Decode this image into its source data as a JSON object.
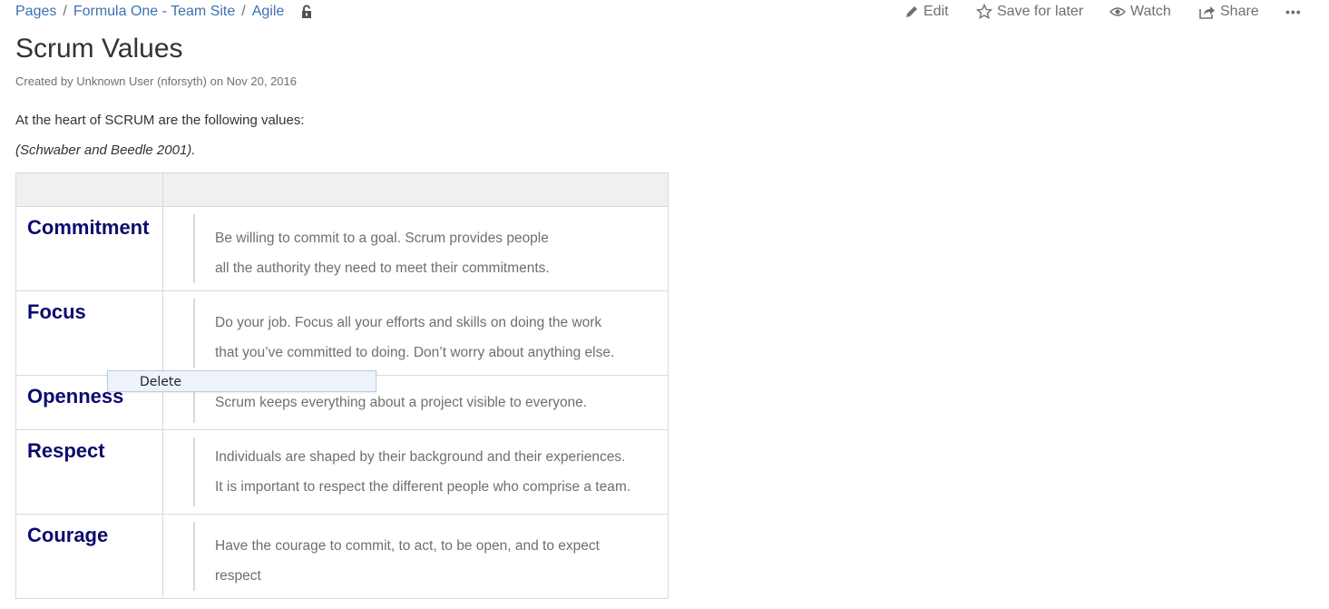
{
  "breadcrumb": {
    "items": [
      "Pages",
      "Formula One - Team Site",
      "Agile"
    ],
    "separator": "/"
  },
  "actions": {
    "edit": "Edit",
    "save_for_later": "Save for later",
    "watch": "Watch",
    "share": "Share",
    "more": "•••"
  },
  "page": {
    "title": "Scrum Values",
    "byline": "Created by Unknown User (nforsyth) on Nov 20, 2016",
    "intro": "At the heart of SCRUM are the following values:",
    "citation": "(Schwaber and Beedle 2001)."
  },
  "table": {
    "rows": [
      {
        "term": "Commitment",
        "lines": [
          "Be willing to commit to a goal. Scrum provides people",
          "all the authority they need to meet their commitments."
        ]
      },
      {
        "term": "Focus",
        "lines": [
          "Do your job. Focus all your efforts and skills on doing the work",
          "that you’ve committed to doing. Don’t worry about anything else."
        ]
      },
      {
        "term": "Openness",
        "lines": [
          "Scrum keeps everything about a project visible to everyone."
        ]
      },
      {
        "term": "Respect",
        "lines": [
          "Individuals are shaped by their background and their experiences.",
          "It is important to respect the different people who comprise a team."
        ]
      },
      {
        "term": "Courage",
        "lines": [
          "Have the courage to commit, to act, to be open, and to expect",
          "respect"
        ]
      }
    ]
  },
  "context_menu": {
    "delete": "Delete"
  },
  "colors": {
    "link": "#3b73af",
    "term": "#0b0b6e",
    "muted": "#707070"
  }
}
